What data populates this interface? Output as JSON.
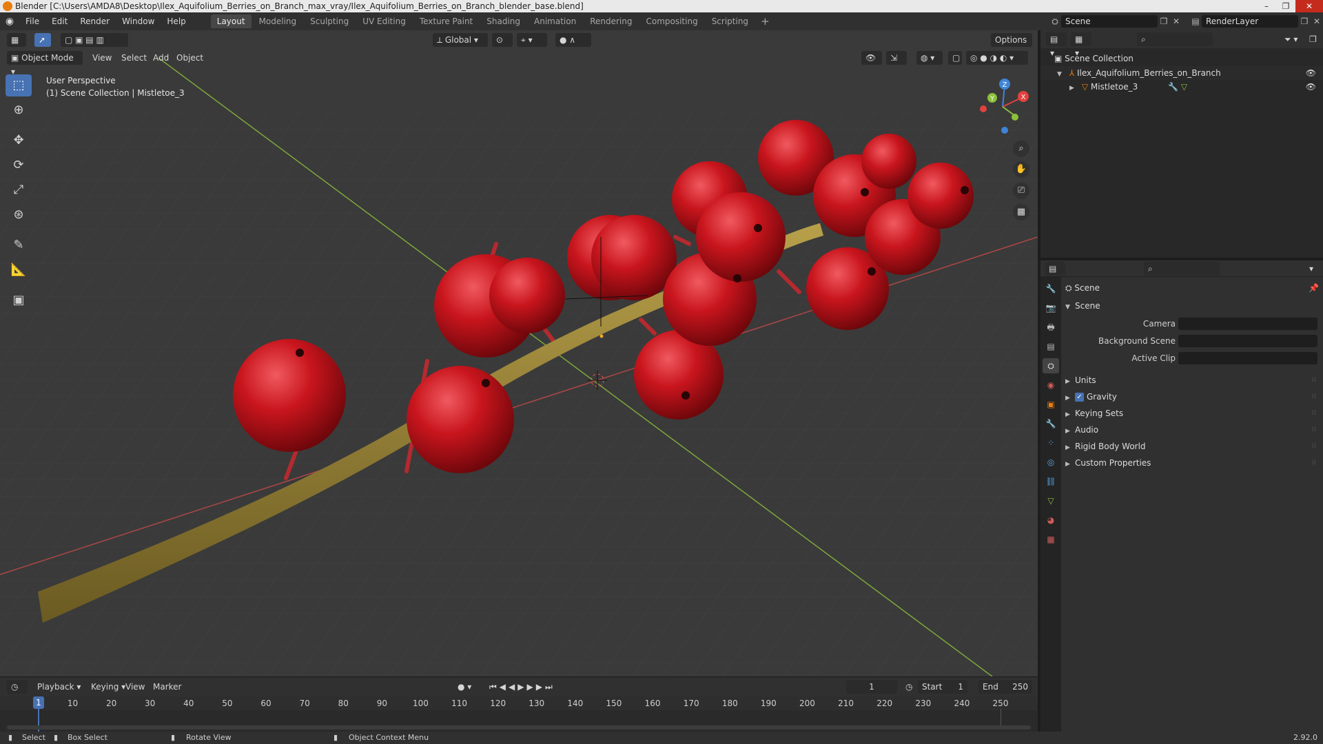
{
  "window": {
    "title": "Blender [C:\\Users\\AMDA8\\Desktop\\Ilex_Aquifolium_Berries_on_Branch_max_vray/Ilex_Aquifolium_Berries_on_Branch_blender_base.blend]",
    "min": "–",
    "max": "❐",
    "close": "✕"
  },
  "menu": [
    "File",
    "Edit",
    "Render",
    "Window",
    "Help"
  ],
  "workspaces": {
    "tabs": [
      "Layout",
      "Modeling",
      "Sculpting",
      "UV Editing",
      "Texture Paint",
      "Shading",
      "Animation",
      "Rendering",
      "Compositing",
      "Scripting"
    ],
    "active": "Layout",
    "add": "+"
  },
  "topright": {
    "scene": "Scene",
    "render_layer": "RenderLayer"
  },
  "viewport": {
    "mode": "Object Mode",
    "menus": [
      "View",
      "Select",
      "Add",
      "Object"
    ],
    "transform_orientation": "Global",
    "options": "Options",
    "perspective": "User Perspective",
    "collection_info": "(1) Scene Collection | Mistletoe_3",
    "gizmo": {
      "x": "X",
      "y": "Y",
      "z": "Z"
    }
  },
  "outliner": {
    "root": "Scene Collection",
    "items": [
      {
        "label": "Ilex_Aquifolium_Berries_on_Branch"
      },
      {
        "label": "Mistletoe_3"
      }
    ]
  },
  "properties": {
    "context": "Scene",
    "panel_title": "Scene",
    "fields": [
      {
        "label": "Camera"
      },
      {
        "label": "Background Scene"
      },
      {
        "label": "Active Clip"
      }
    ],
    "sections": [
      "Units",
      "Gravity",
      "Keying Sets",
      "Audio",
      "Rigid Body World",
      "Custom Properties"
    ],
    "gravity_checked": true,
    "checkmark": "✓"
  },
  "timeline": {
    "menus": [
      "Playback",
      "Keying",
      "View",
      "Marker"
    ],
    "current_frame": "1",
    "start_label": "Start",
    "start": "1",
    "end_label": "End",
    "end": "250",
    "cursor": "1",
    "ticks": [
      "10",
      "20",
      "30",
      "40",
      "50",
      "60",
      "70",
      "80",
      "90",
      "100",
      "110",
      "120",
      "130",
      "140",
      "150",
      "160",
      "170",
      "180",
      "190",
      "200",
      "210",
      "220",
      "230",
      "240",
      "250"
    ]
  },
  "status": {
    "select": "Select",
    "box_select": "Box Select",
    "rotate_view": "Rotate View",
    "context_menu": "Object Context Menu",
    "version": "2.92.0"
  },
  "colors": {
    "accent": "#4772b3",
    "x_axis": "#e2413f",
    "y_axis": "#8cc13a",
    "z_axis": "#3e85d8",
    "berry": "#c0161c",
    "branch": "#8a7a2e"
  }
}
